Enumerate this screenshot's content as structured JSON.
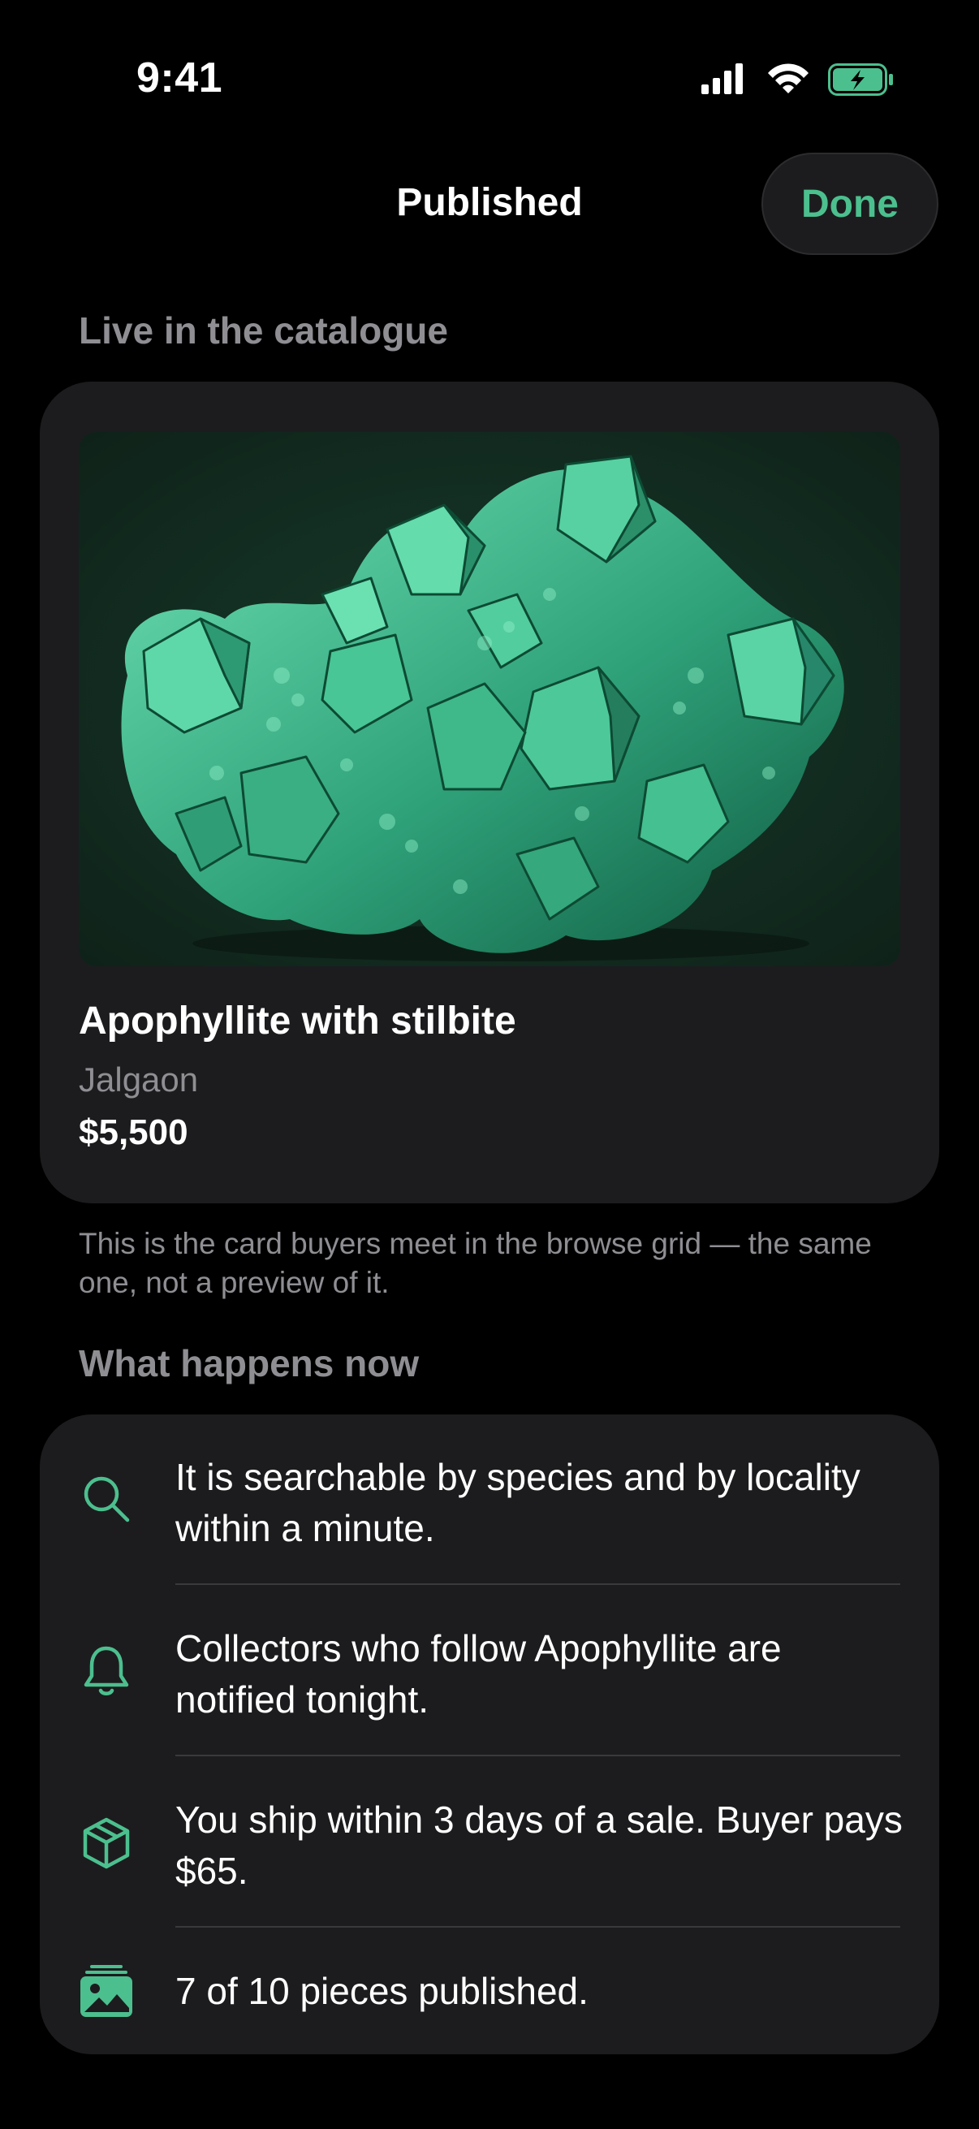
{
  "status_bar": {
    "time": "9:41",
    "icons": [
      "cellular-signal-icon",
      "wifi-icon",
      "battery-charging-icon"
    ]
  },
  "nav": {
    "title": "Published",
    "done_label": "Done"
  },
  "live_section": {
    "header": "Live in the catalogue",
    "card": {
      "image": "apophyllite-specimen-photo",
      "title": "Apophyllite with stilbite",
      "locality": "Jalgaon",
      "price": "$5,500"
    },
    "footnote": "This is the card buyers meet in the browse grid — the same one, not a preview of it."
  },
  "next_section": {
    "header": "What happens now",
    "items": [
      {
        "icon": "search-icon",
        "text": "It is searchable by species and by locality within a minute."
      },
      {
        "icon": "bell-icon",
        "text": "Collectors who follow Apophyllite are notified tonight."
      },
      {
        "icon": "package-icon",
        "text": "You ship within 3 days of a sale. Buyer pays $65."
      },
      {
        "icon": "photo-stack-icon",
        "text": "7 of 10 pieces published."
      }
    ]
  },
  "colors": {
    "accent": "#4cbf8e",
    "background": "#000000",
    "card": "#1c1c1e",
    "secondary_text": "#8e8e93",
    "divider": "#3a3a3c"
  }
}
